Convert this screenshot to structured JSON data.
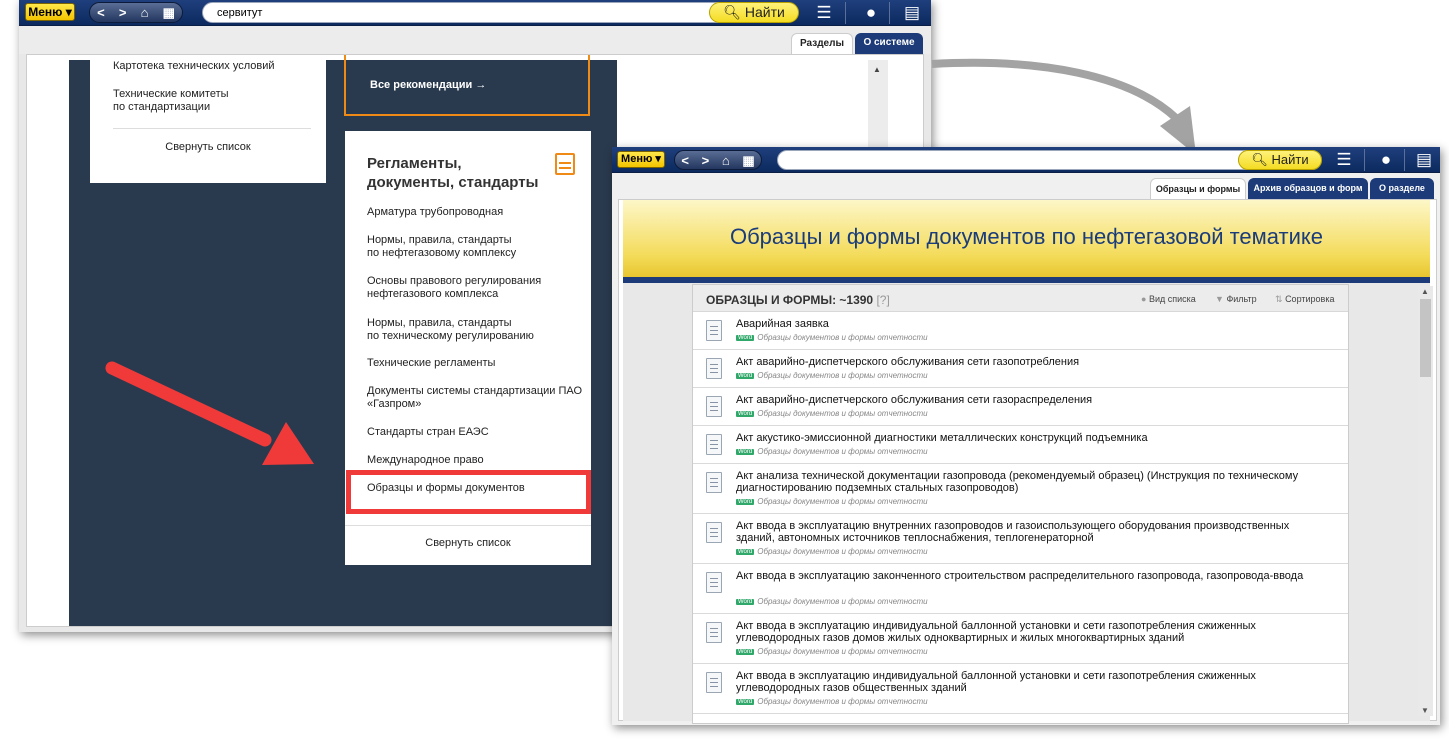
{
  "window1": {
    "toolbar": {
      "menu_label": "Меню",
      "search_value": "сервитут",
      "find_label": "Найти"
    },
    "tabs": [
      "Разделы",
      "О системе"
    ],
    "left_card": {
      "items": [
        "Картотека технических условий",
        "Технические комитеты\nпо стандартизации"
      ],
      "collapse_label": "Свернуть список"
    },
    "all_recommendations_label": "Все рекомендации →",
    "regulations_card": {
      "title": "Регламенты,\nдокументы, стандарты",
      "items": [
        "Арматура трубопроводная",
        "Нормы, правила, стандарты\nпо нефтегазовому комплексу",
        "Основы правового регулирования\nнефтегазового комплекса",
        "Нормы, правила, стандарты\nпо техническому регулированию",
        "Технические регламенты",
        "Документы системы стандартизации ПАО\n«Газпром»",
        "Стандарты стран ЕАЭС",
        "Международное право",
        "Образцы и формы документов"
      ],
      "collapse_label": "Свернуть список"
    }
  },
  "window2": {
    "toolbar": {
      "menu_label": "Меню",
      "search_value": "",
      "find_label": "Найти"
    },
    "tabs": [
      "Образцы и формы",
      "Архив образцов и форм",
      "О разделе"
    ],
    "banner_title": "Образцы и формы документов по нефтегазовой тематике",
    "list_header": {
      "title": "ОБРАЗЦЫ И ФОРМЫ: ~1390",
      "help": "[?]",
      "view_label": "Вид списка",
      "filter_label": "Фильтр",
      "sort_label": "Сортировка"
    },
    "badge_label": "Word",
    "category_label": "Образцы документов и формы отчетности",
    "documents": [
      "Аварийная заявка",
      "Акт аварийно-диспетчерского обслуживания сети газопотребления",
      "Акт аварийно-диспетчерского обслуживания сети газораспределения",
      "Акт акустико-эмиссионной диагностики металлических конструкций подъемника",
      "Акт анализа технической документации газопровода (рекомендуемый образец) (Инструкция по техническому диагностированию подземных стальных газопроводов)",
      "Акт ввода в эксплуатацию внутренних газопроводов и газоиспользующего оборудования производственных зданий, автономных источников теплоснабжения, теплогенераторной",
      "Акт ввода в эксплуатацию законченного строительством распределительного газопровода, газопровода-ввода",
      "Акт ввода в эксплуатацию индивидуальной баллонной установки и сети газопотребления сжиженных углеводородных газов домов жилых одноквартирных и жилых многоквартирных зданий",
      "Акт ввода в эксплуатацию индивидуальной баллонной установки и сети газопотребления сжиженных углеводородных газов общественных зданий"
    ]
  },
  "colors": {
    "highlight": "#f03a3a",
    "orange_border": "#f08a17",
    "dark_panel": "#2a3a4e",
    "toolbar": "#173470",
    "banner": "#f3da56",
    "arrow_gray": "#a3a3a3"
  }
}
